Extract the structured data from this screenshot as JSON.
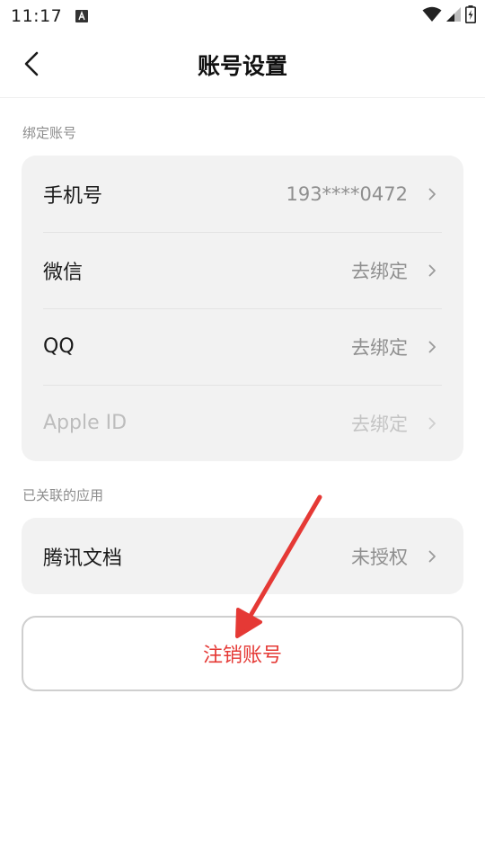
{
  "status_bar": {
    "time": "11:17"
  },
  "header": {
    "title": "账号设置"
  },
  "bound_accounts": {
    "section_label": "绑定账号",
    "items": [
      {
        "label": "手机号",
        "value": "193****0472",
        "enabled": true
      },
      {
        "label": "微信",
        "value": "去绑定",
        "enabled": true
      },
      {
        "label": "QQ",
        "value": "去绑定",
        "enabled": true
      },
      {
        "label": "Apple ID",
        "value": "去绑定",
        "enabled": false
      }
    ]
  },
  "linked_apps": {
    "section_label": "已关联的应用",
    "items": [
      {
        "label": "腾讯文档",
        "value": "未授权",
        "enabled": true
      }
    ]
  },
  "deregister": {
    "label": "注销账号"
  },
  "colors": {
    "danger": "#e53935",
    "card_bg": "#f2f2f2",
    "secondary_text": "#8f8f8f"
  }
}
